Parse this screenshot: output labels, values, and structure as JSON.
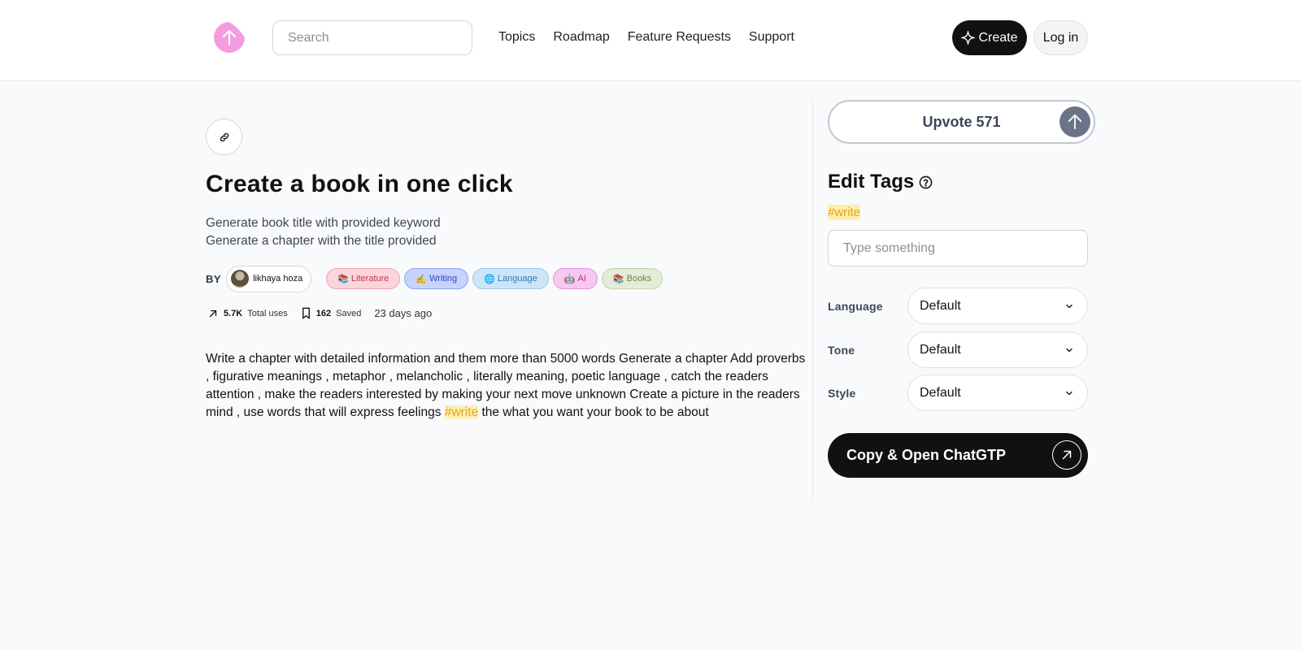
{
  "header": {
    "search_placeholder": "Search",
    "nav": [
      "Topics",
      "Roadmap",
      "Feature Requests",
      "Support"
    ],
    "create_label": "Create",
    "login_label": "Log in"
  },
  "prompt": {
    "title": "Create a book in one click",
    "subtitle_lines": [
      "Generate book title with provided keyword",
      "Generate a chapter with the title provided"
    ],
    "by_label": "BY",
    "author": "likhaya hoza",
    "tags": [
      {
        "emoji": "📚",
        "label": "Literature"
      },
      {
        "emoji": "✍️",
        "label": "Writing"
      },
      {
        "emoji": "🌐",
        "label": "Language"
      },
      {
        "emoji": "🤖",
        "label": "AI"
      },
      {
        "emoji": "📚",
        "label": "Books"
      }
    ],
    "stats": {
      "uses_value": "5.7K",
      "uses_label": "Total uses",
      "saved_value": "162",
      "saved_label": "Saved",
      "time": "23 days ago"
    },
    "body_before": "Write a chapter with detailed information and them more than 5000 words Generate a chapter Add proverbs , figurative meanings , metaphor , melancholic , literally meaning, poetic language , catch the readers attention , make the readers interested by making your next move unknown Create a picture in the readers mind , use words that will express feelings ",
    "body_highlight": "#write",
    "body_after": " the what you want your book to be about"
  },
  "sidebar": {
    "upvote_label": "Upvote 571",
    "edit_tags_label": "Edit Tags",
    "tag_chip": "#write",
    "tag_input_placeholder": "Type something",
    "options": [
      {
        "label": "Language",
        "value": "Default"
      },
      {
        "label": "Tone",
        "value": "Default"
      },
      {
        "label": "Style",
        "value": "Default"
      }
    ],
    "copy_label": "Copy & Open ChatGTP"
  },
  "colors": {
    "accent_pink": "#f7a6e6",
    "dark": "#111111",
    "highlight": "#fdeeb0"
  }
}
